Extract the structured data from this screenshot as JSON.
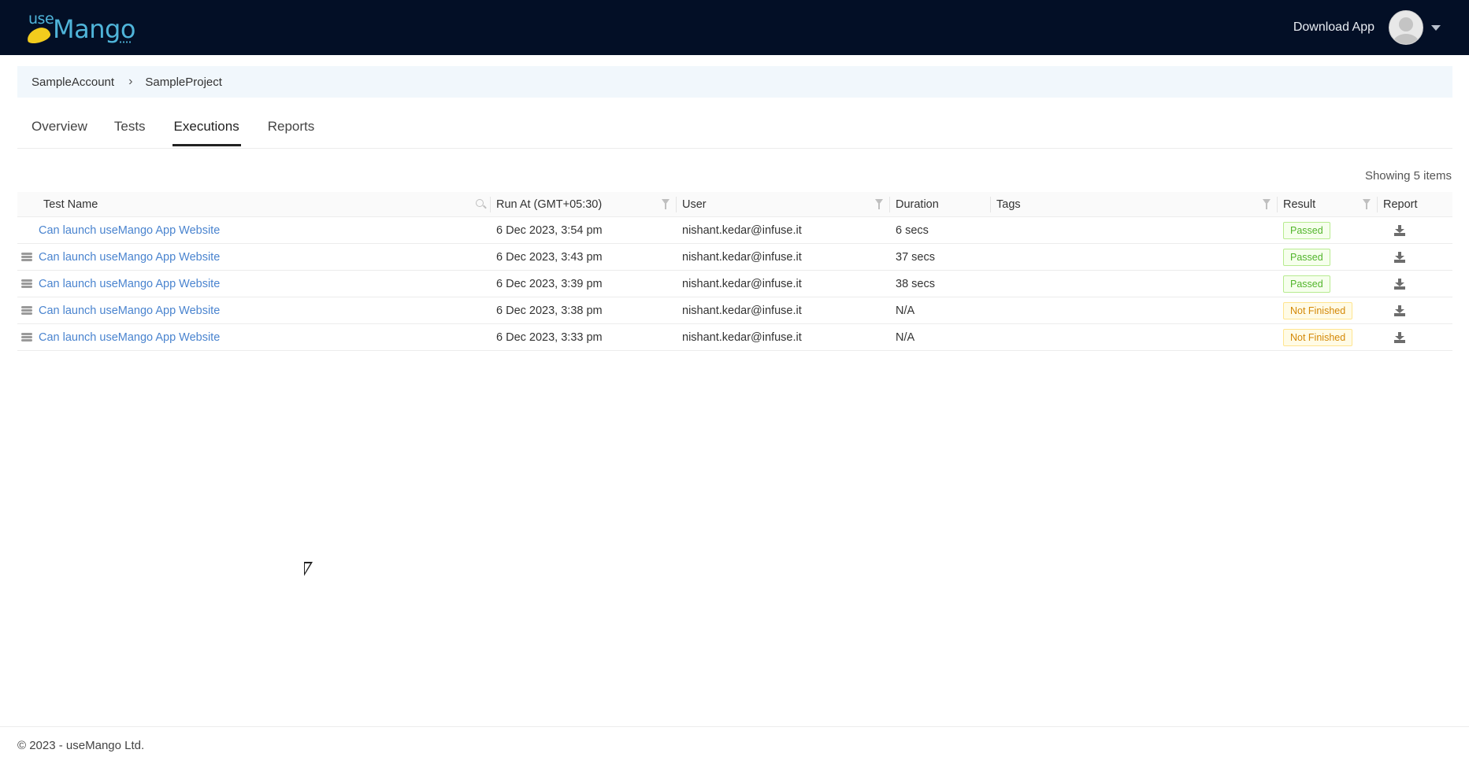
{
  "header": {
    "logo_prefix": "use",
    "logo_name": "Mango",
    "download_label": "Download App",
    "bg_color": "#030f26",
    "logo_color": "#4fb4d9",
    "logo_mango_color": "#f2cc1d"
  },
  "breadcrumb": {
    "account": "SampleAccount",
    "separator": "›",
    "project": "SampleProject"
  },
  "tabs": [
    {
      "label": "Overview",
      "active": false
    },
    {
      "label": "Tests",
      "active": false
    },
    {
      "label": "Executions",
      "active": true
    },
    {
      "label": "Reports",
      "active": false
    }
  ],
  "summary": "Showing 5 items",
  "table": {
    "columns": {
      "name": "Test Name",
      "run_at": "Run At (GMT+05:30)",
      "user": "User",
      "duration": "Duration",
      "tags": "Tags",
      "result": "Result",
      "report": "Report"
    },
    "rows": [
      {
        "name": "Can launch useMango App Website",
        "run_at": "6 Dec 2023, 3:54 pm",
        "user": "nishant.kedar@infuse.it",
        "duration": "6 secs",
        "tags": "",
        "result": "Passed",
        "has_data_icon": false
      },
      {
        "name": "Can launch useMango App Website",
        "run_at": "6 Dec 2023, 3:43 pm",
        "user": "nishant.kedar@infuse.it",
        "duration": "37 secs",
        "tags": "",
        "result": "Passed",
        "has_data_icon": true
      },
      {
        "name": "Can launch useMango App Website",
        "run_at": "6 Dec 2023, 3:39 pm",
        "user": "nishant.kedar@infuse.it",
        "duration": "38 secs",
        "tags": "",
        "result": "Passed",
        "has_data_icon": true
      },
      {
        "name": "Can launch useMango App Website",
        "run_at": "6 Dec 2023, 3:38 pm",
        "user": "nishant.kedar@infuse.it",
        "duration": "N/A",
        "tags": "",
        "result": "Not Finished",
        "has_data_icon": true
      },
      {
        "name": "Can launch useMango App Website",
        "run_at": "6 Dec 2023, 3:33 pm",
        "user": "nishant.kedar@infuse.it",
        "duration": "N/A",
        "tags": "",
        "result": "Not Finished",
        "has_data_icon": true
      }
    ]
  },
  "footer": {
    "copyright": "© 2023 - useMango Ltd."
  }
}
